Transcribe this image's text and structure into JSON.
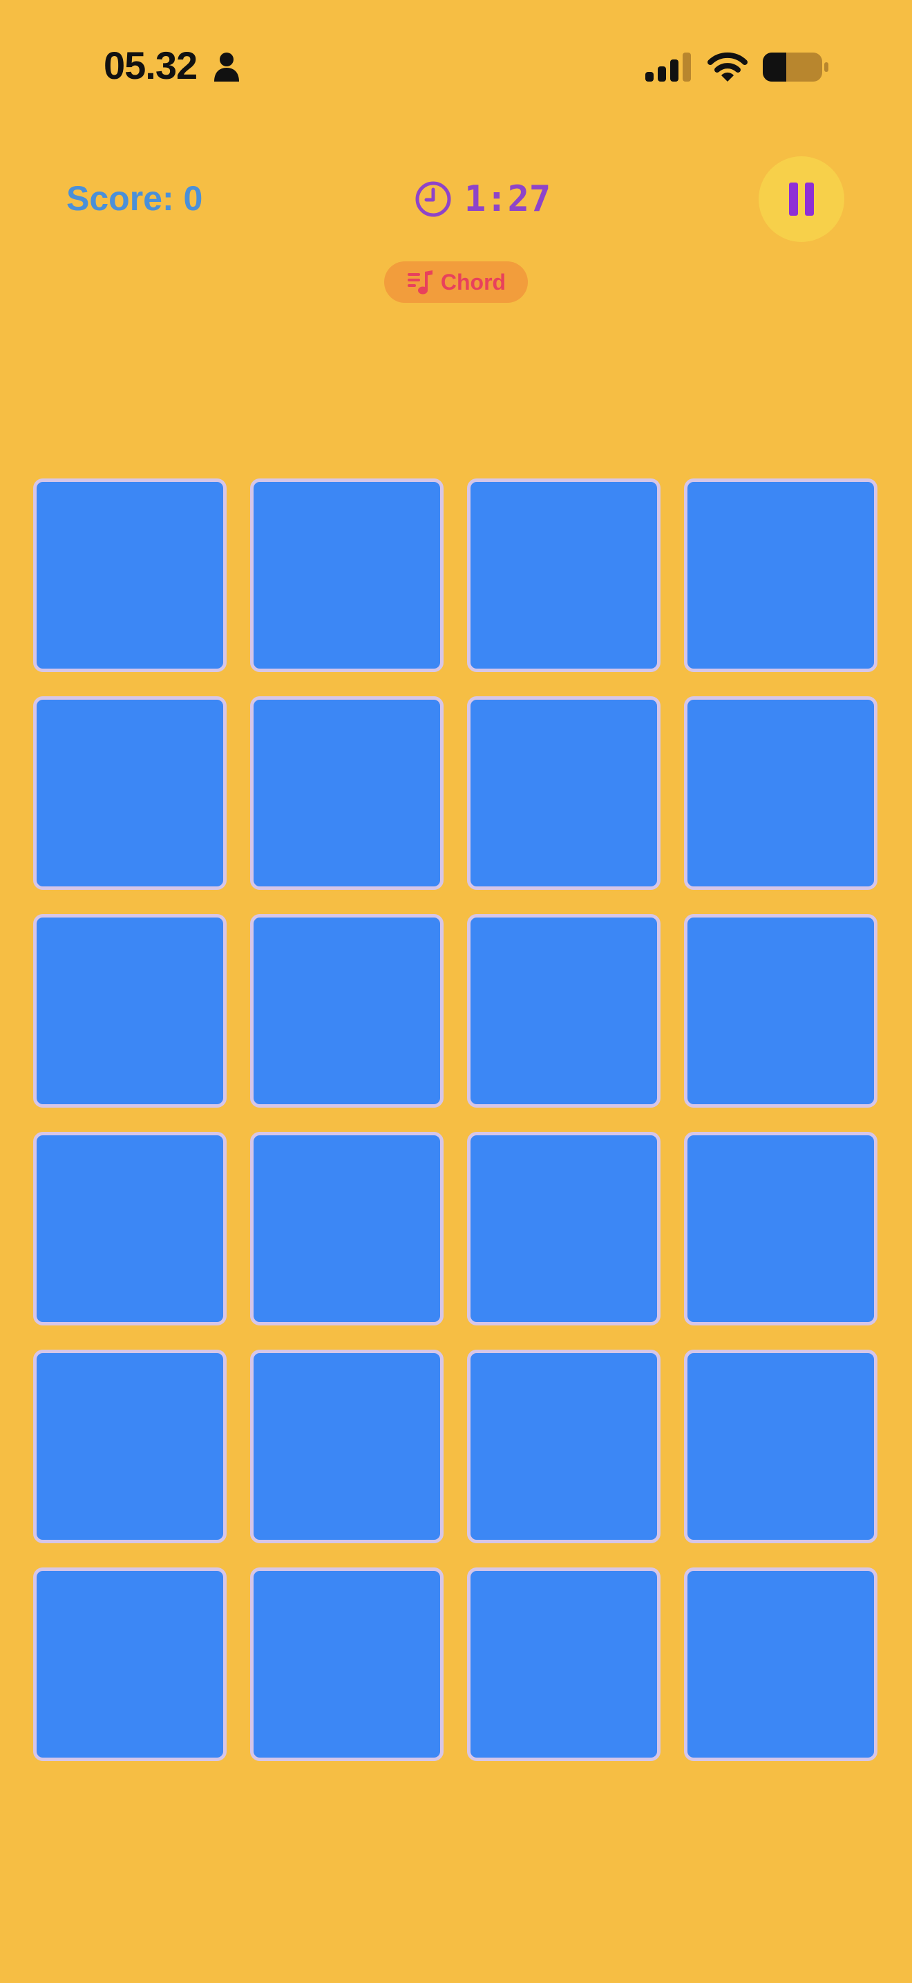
{
  "status_bar": {
    "time": "05.32",
    "icons": [
      "person-icon",
      "signal-icon",
      "wifi-icon",
      "battery-icon"
    ]
  },
  "header": {
    "score": "Score: 0",
    "timer": "1:27",
    "pause_icon": "pause-icon"
  },
  "mode": {
    "label": "Chord",
    "icon": "music-note-list-icon"
  },
  "board": {
    "rows": 6,
    "columns": 4,
    "tiles_face_down": 24
  },
  "colors": {
    "background": "#F6BE44",
    "tile": "#3C87F5",
    "tile_border": "#D6C6E8",
    "score": "#4A90D9",
    "timer": "#8E44C9",
    "pause_button": "#F7D04A",
    "mode_badge": "#F29D3C",
    "mode_text": "#E8415C"
  }
}
